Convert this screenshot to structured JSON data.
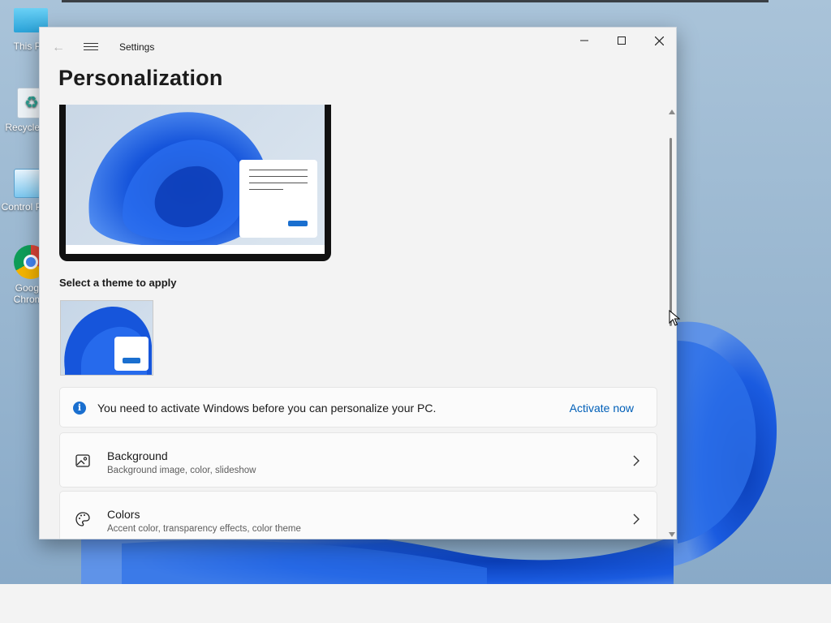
{
  "desktop": {
    "icons": [
      {
        "label": "This PC"
      },
      {
        "label": "Recycle Bin"
      },
      {
        "label": "Control Panel"
      },
      {
        "label": "Google Chrome"
      }
    ]
  },
  "window": {
    "app_title": "Settings",
    "page_title": "Personalization",
    "controls": {
      "minimize": "minimize-icon",
      "maximize": "maximize-icon",
      "close": "close-icon"
    }
  },
  "themes": {
    "label": "Select a theme to apply"
  },
  "activation": {
    "message": "You need to activate Windows before you can personalize your PC.",
    "link": "Activate now"
  },
  "settings_rows": [
    {
      "title": "Background",
      "subtitle": "Background image, color, slideshow",
      "icon": "image-icon"
    },
    {
      "title": "Colors",
      "subtitle": "Accent color, transparency effects, color theme",
      "icon": "palette-icon"
    }
  ],
  "colors": {
    "accent": "#005fb8",
    "bloom_blue": "#1a56d6",
    "window_bg": "#f3f3f3"
  }
}
